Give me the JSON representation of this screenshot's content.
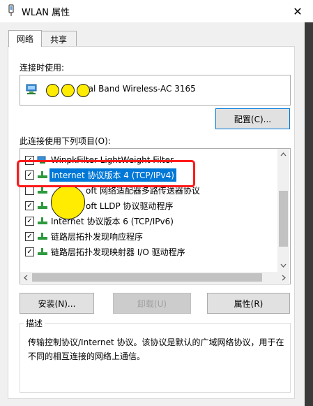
{
  "window": {
    "title": "WLAN 属性",
    "close_glyph": "✕"
  },
  "tabs": [
    {
      "label": "网络"
    },
    {
      "label": "共享"
    }
  ],
  "connect_using": {
    "label": "连接时使用:",
    "adapter_name": "Intel(R) Dual Band Wireless-AC 3165",
    "adapter_name_visible": "ual Band Wireless-AC 3165"
  },
  "configure_button": {
    "label": "配置(C)..."
  },
  "items_label": "此连接使用下列项目(O):",
  "items": [
    {
      "label": "WinpkFilter LightWeight Filter",
      "checked": true,
      "icon": "network-client-icon"
    },
    {
      "label": "Internet 协议版本 4 (TCP/IPv4)",
      "checked": true,
      "selected": true,
      "icon": "protocol-icon"
    },
    {
      "label": "oft 网络适配器多路传送器协议",
      "checked": false,
      "icon": "protocol-icon"
    },
    {
      "label": "oft LLDP 协议驱动程序",
      "checked": true,
      "icon": "protocol-icon"
    },
    {
      "label": "Internet 协议版本 6 (TCP/IPv6)",
      "checked": true,
      "icon": "protocol-icon"
    },
    {
      "label": "链路层拓扑发现响应程序",
      "checked": true,
      "icon": "protocol-icon"
    },
    {
      "label": "链路层拓扑发现映射器 I/O 驱动程序",
      "checked": true,
      "icon": "protocol-icon"
    }
  ],
  "buttons": {
    "install": "安装(N)...",
    "uninstall": "卸载(U)",
    "properties": "属性(R)"
  },
  "description": {
    "legend": "描述",
    "text": "传输控制协议/Internet 协议。该协议是默认的广域网络协议，用于在不同的相互连接的网络上通信。"
  },
  "colors": {
    "selection": "#0078d7",
    "highlight_box": "#ff1a1a",
    "redaction_dot": "#ffec00"
  }
}
